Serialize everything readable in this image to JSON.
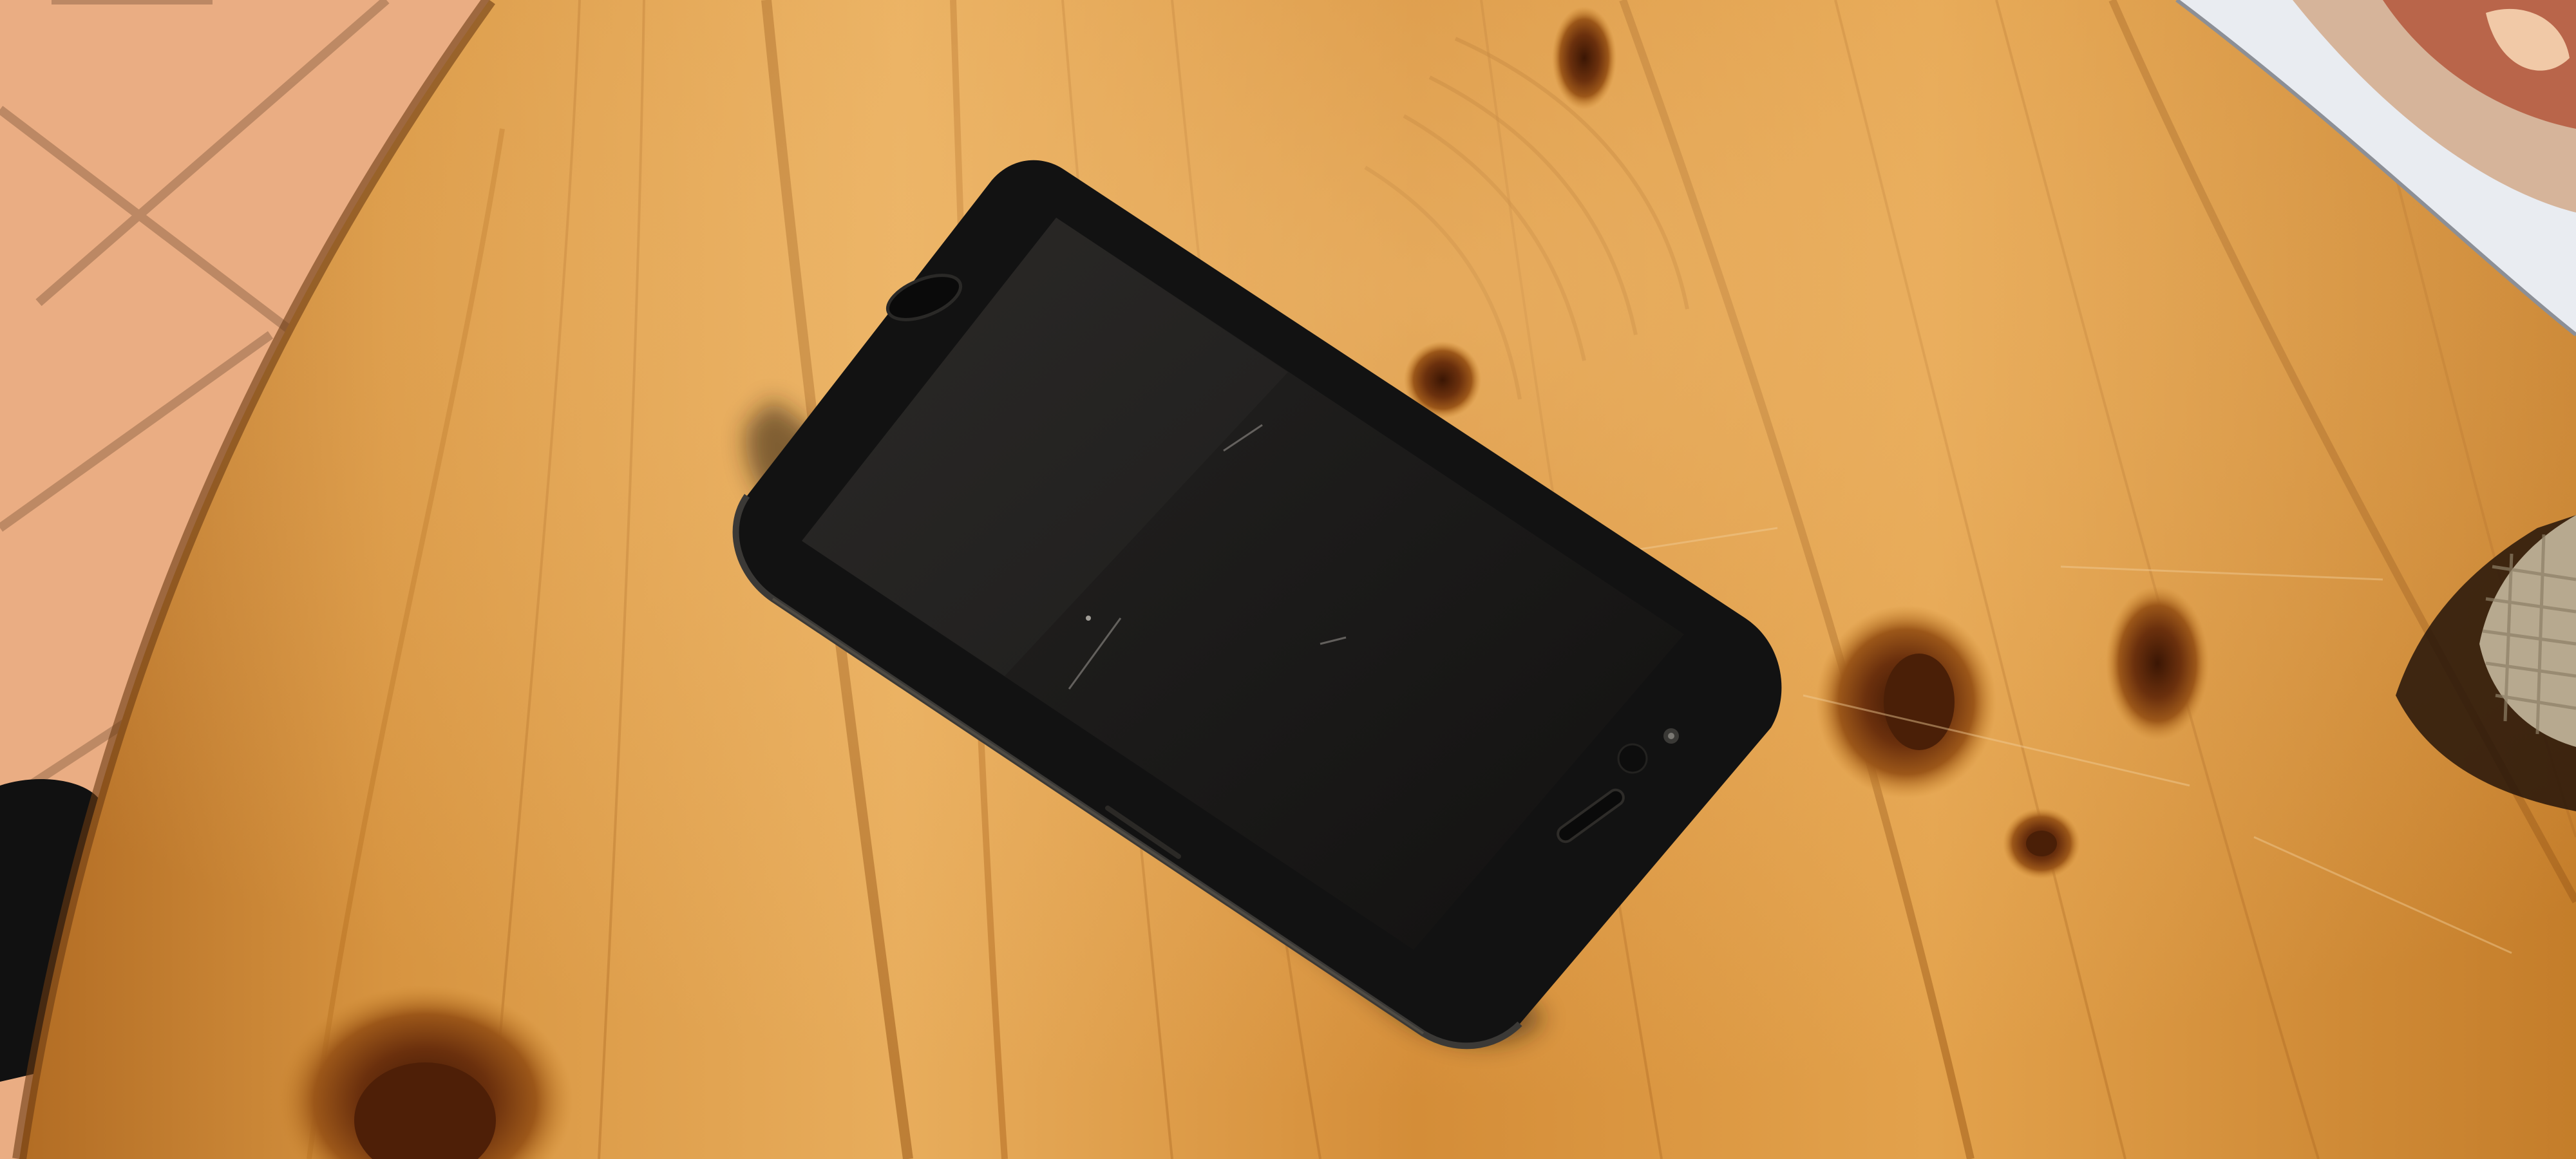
{
  "scene": {
    "subject": "smartphone",
    "phone_state": "screen-off",
    "surface": "wooden-table",
    "palette": {
      "tile": "#e7a97f",
      "grout": "#b88564",
      "wood_light": "#e2a24f",
      "wood_mid": "#c9852f",
      "wood_dark": "#9b5a16",
      "knot": "#5a2a0c",
      "phone_body": "#111111",
      "phone_screen": "#1d1c1b",
      "burlap": "#b5a78e",
      "shadow": "#2a1a0d"
    }
  }
}
